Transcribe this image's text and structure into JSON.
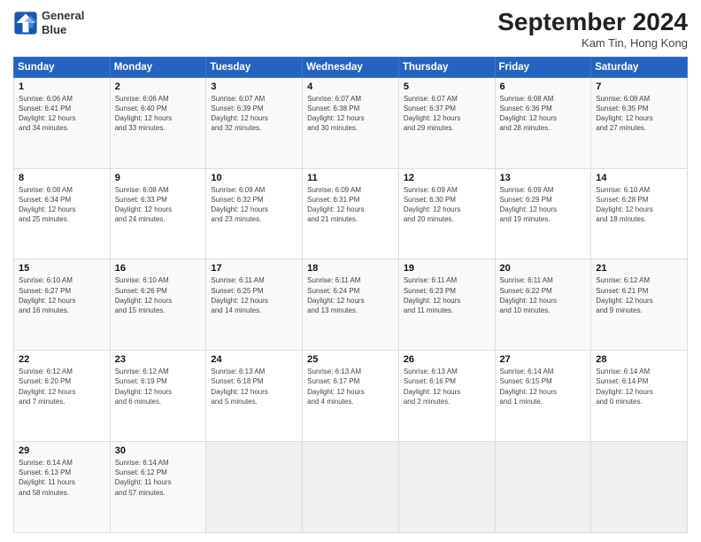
{
  "header": {
    "logo_line1": "General",
    "logo_line2": "Blue",
    "month": "September 2024",
    "location": "Kam Tin, Hong Kong"
  },
  "weekdays": [
    "Sunday",
    "Monday",
    "Tuesday",
    "Wednesday",
    "Thursday",
    "Friday",
    "Saturday"
  ],
  "weeks": [
    [
      {
        "day": "1",
        "info": "Sunrise: 6:06 AM\nSunset: 6:41 PM\nDaylight: 12 hours\nand 34 minutes."
      },
      {
        "day": "2",
        "info": "Sunrise: 6:06 AM\nSunset: 6:40 PM\nDaylight: 12 hours\nand 33 minutes."
      },
      {
        "day": "3",
        "info": "Sunrise: 6:07 AM\nSunset: 6:39 PM\nDaylight: 12 hours\nand 32 minutes."
      },
      {
        "day": "4",
        "info": "Sunrise: 6:07 AM\nSunset: 6:38 PM\nDaylight: 12 hours\nand 30 minutes."
      },
      {
        "day": "5",
        "info": "Sunrise: 6:07 AM\nSunset: 6:37 PM\nDaylight: 12 hours\nand 29 minutes."
      },
      {
        "day": "6",
        "info": "Sunrise: 6:08 AM\nSunset: 6:36 PM\nDaylight: 12 hours\nand 28 minutes."
      },
      {
        "day": "7",
        "info": "Sunrise: 6:08 AM\nSunset: 6:35 PM\nDaylight: 12 hours\nand 27 minutes."
      }
    ],
    [
      {
        "day": "8",
        "info": "Sunrise: 6:08 AM\nSunset: 6:34 PM\nDaylight: 12 hours\nand 25 minutes."
      },
      {
        "day": "9",
        "info": "Sunrise: 6:08 AM\nSunset: 6:33 PM\nDaylight: 12 hours\nand 24 minutes."
      },
      {
        "day": "10",
        "info": "Sunrise: 6:09 AM\nSunset: 6:32 PM\nDaylight: 12 hours\nand 23 minutes."
      },
      {
        "day": "11",
        "info": "Sunrise: 6:09 AM\nSunset: 6:31 PM\nDaylight: 12 hours\nand 21 minutes."
      },
      {
        "day": "12",
        "info": "Sunrise: 6:09 AM\nSunset: 6:30 PM\nDaylight: 12 hours\nand 20 minutes."
      },
      {
        "day": "13",
        "info": "Sunrise: 6:09 AM\nSunset: 6:29 PM\nDaylight: 12 hours\nand 19 minutes."
      },
      {
        "day": "14",
        "info": "Sunrise: 6:10 AM\nSunset: 6:28 PM\nDaylight: 12 hours\nand 18 minutes."
      }
    ],
    [
      {
        "day": "15",
        "info": "Sunrise: 6:10 AM\nSunset: 6:27 PM\nDaylight: 12 hours\nand 16 minutes."
      },
      {
        "day": "16",
        "info": "Sunrise: 6:10 AM\nSunset: 6:26 PM\nDaylight: 12 hours\nand 15 minutes."
      },
      {
        "day": "17",
        "info": "Sunrise: 6:11 AM\nSunset: 6:25 PM\nDaylight: 12 hours\nand 14 minutes."
      },
      {
        "day": "18",
        "info": "Sunrise: 6:11 AM\nSunset: 6:24 PM\nDaylight: 12 hours\nand 13 minutes."
      },
      {
        "day": "19",
        "info": "Sunrise: 6:11 AM\nSunset: 6:23 PM\nDaylight: 12 hours\nand 11 minutes."
      },
      {
        "day": "20",
        "info": "Sunrise: 6:11 AM\nSunset: 6:22 PM\nDaylight: 12 hours\nand 10 minutes."
      },
      {
        "day": "21",
        "info": "Sunrise: 6:12 AM\nSunset: 6:21 PM\nDaylight: 12 hours\nand 9 minutes."
      }
    ],
    [
      {
        "day": "22",
        "info": "Sunrise: 6:12 AM\nSunset: 6:20 PM\nDaylight: 12 hours\nand 7 minutes."
      },
      {
        "day": "23",
        "info": "Sunrise: 6:12 AM\nSunset: 6:19 PM\nDaylight: 12 hours\nand 6 minutes."
      },
      {
        "day": "24",
        "info": "Sunrise: 6:13 AM\nSunset: 6:18 PM\nDaylight: 12 hours\nand 5 minutes."
      },
      {
        "day": "25",
        "info": "Sunrise: 6:13 AM\nSunset: 6:17 PM\nDaylight: 12 hours\nand 4 minutes."
      },
      {
        "day": "26",
        "info": "Sunrise: 6:13 AM\nSunset: 6:16 PM\nDaylight: 12 hours\nand 2 minutes."
      },
      {
        "day": "27",
        "info": "Sunrise: 6:14 AM\nSunset: 6:15 PM\nDaylight: 12 hours\nand 1 minute."
      },
      {
        "day": "28",
        "info": "Sunrise: 6:14 AM\nSunset: 6:14 PM\nDaylight: 12 hours\nand 0 minutes."
      }
    ],
    [
      {
        "day": "29",
        "info": "Sunrise: 6:14 AM\nSunset: 6:13 PM\nDaylight: 11 hours\nand 58 minutes."
      },
      {
        "day": "30",
        "info": "Sunrise: 6:14 AM\nSunset: 6:12 PM\nDaylight: 11 hours\nand 57 minutes."
      },
      {
        "day": "",
        "info": ""
      },
      {
        "day": "",
        "info": ""
      },
      {
        "day": "",
        "info": ""
      },
      {
        "day": "",
        "info": ""
      },
      {
        "day": "",
        "info": ""
      }
    ]
  ]
}
